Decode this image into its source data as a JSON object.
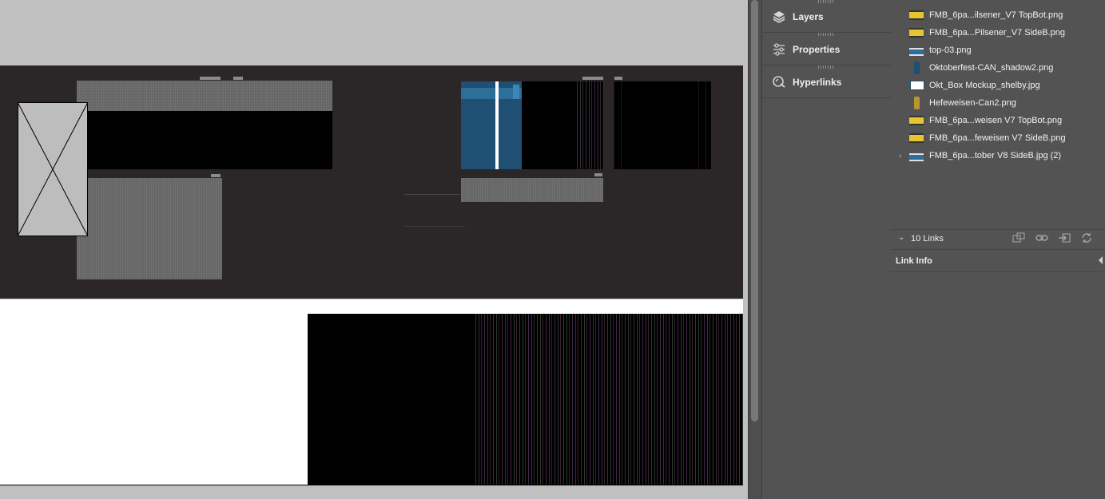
{
  "panels": {
    "tabs": [
      {
        "label": "Layers",
        "icon": "layers-icon"
      },
      {
        "label": "Properties",
        "icon": "sliders-icon"
      },
      {
        "label": "Hyperlinks",
        "icon": "chain-link-icon"
      }
    ]
  },
  "links_panel": {
    "items": [
      {
        "name": "FMB_6pa...ilsener_V7 TopBot.png",
        "thumb": "yellow-label"
      },
      {
        "name": "FMB_6pa...Pilsener_V7 SideB.png",
        "thumb": "yellow-label"
      },
      {
        "name": "top-03.png",
        "thumb": "blue-label"
      },
      {
        "name": "Oktoberfest-CAN_shadow2.png",
        "thumb": "can-blue"
      },
      {
        "name": "Okt_Box Mockup_shelby.jpg",
        "thumb": "box-white"
      },
      {
        "name": "Hefeweisen-Can2.png",
        "thumb": "can-gold"
      },
      {
        "name": "FMB_6pa...weisen V7 TopBot.png",
        "thumb": "yellow-label"
      },
      {
        "name": "FMB_6pa...feweisen V7 SideB.png",
        "thumb": "yellow-label"
      },
      {
        "name": "FMB_6pa...tober V8 SideB.jpg (2)",
        "thumb": "blue-label",
        "expandable": true
      }
    ],
    "count_label": "10 Links",
    "link_info_label": "Link Info"
  },
  "colors": {
    "panel_bg": "#535353",
    "pasteboard": "#c0c0c0",
    "spread_dark": "#2b2729",
    "label_blue": "#1f4f72",
    "label_yellow": "#e8c430"
  }
}
